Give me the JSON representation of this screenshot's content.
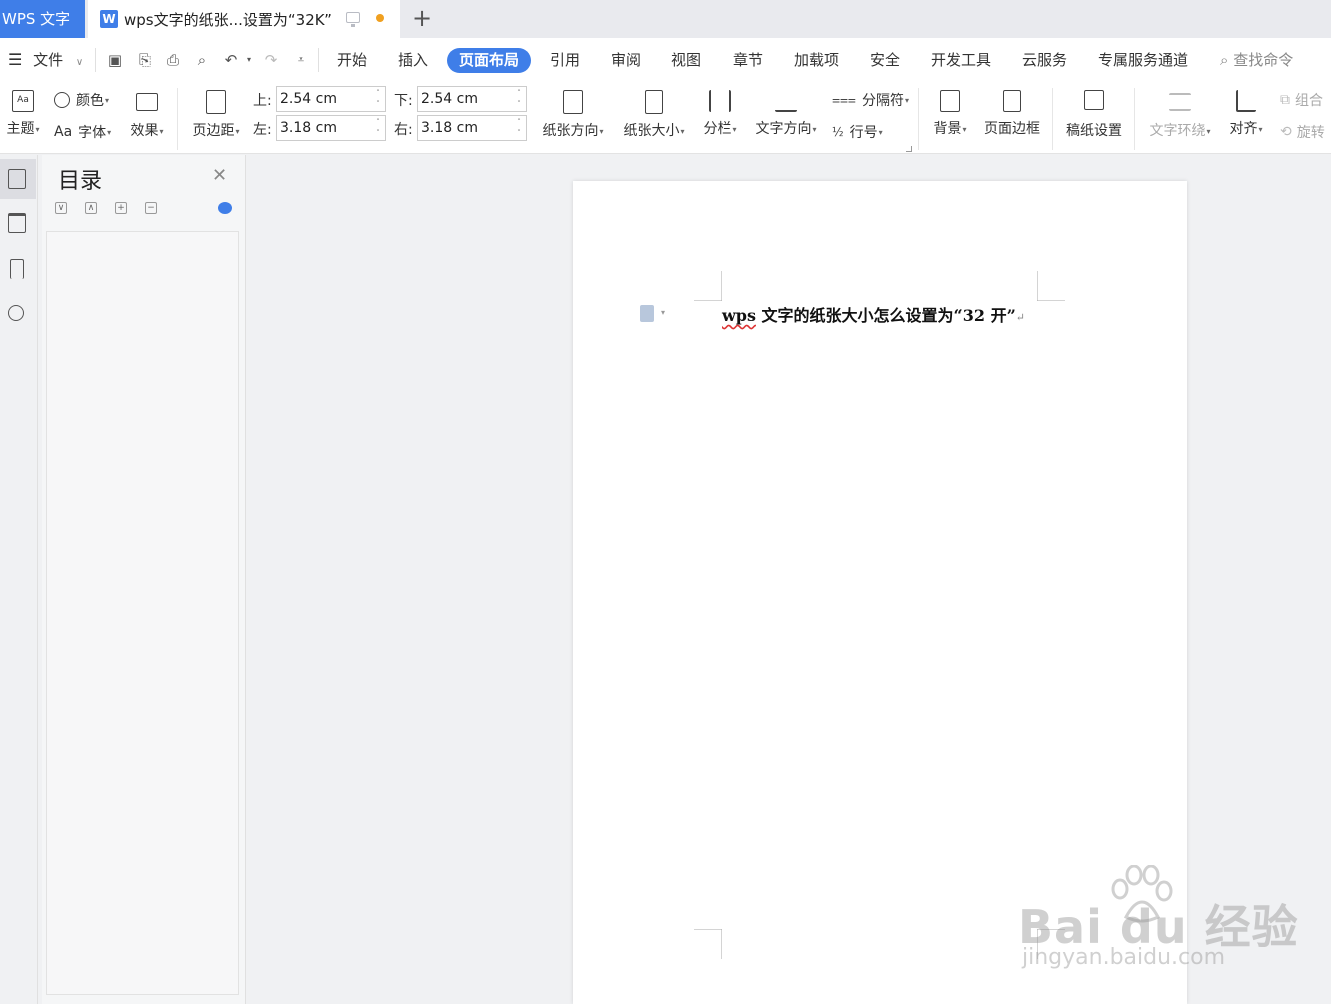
{
  "titlebar": {
    "app_name": "WPS 文字",
    "doc_tab_icon": "W",
    "doc_tab_title": "wps文字的纸张...设置为“32K”",
    "new_tab": "+"
  },
  "menu": {
    "file": "文件",
    "items": [
      "开始",
      "插入",
      "页面布局",
      "引用",
      "审阅",
      "视图",
      "章节",
      "加载项",
      "安全",
      "开发工具",
      "云服务",
      "专属服务通道"
    ],
    "active": "页面布局",
    "search_placeholder": "查找命令"
  },
  "ribbon": {
    "theme": "主题",
    "color": "颜色",
    "font": "字体",
    "font_prefix": "Aa",
    "effect": "效果",
    "margins": "页边距",
    "margin_top_label": "上:",
    "margin_top_value": "2.54 cm",
    "margin_bottom_label": "下:",
    "margin_bottom_value": "2.54 cm",
    "margin_left_label": "左:",
    "margin_left_value": "3.18 cm",
    "margin_right_label": "右:",
    "margin_right_value": "3.18 cm",
    "orientation": "纸张方向",
    "paper_size": "纸张大小",
    "columns": "分栏",
    "text_direction": "文字方向",
    "breaks": "分隔符",
    "line_numbers": "行号",
    "background": "背景",
    "page_border": "页面边框",
    "manuscript": "稿纸设置",
    "text_wrap": "文字环绕",
    "align": "对齐",
    "group": "组合",
    "rotate": "旋转"
  },
  "toc": {
    "title": "目录"
  },
  "document": {
    "heading_prefix": "wps",
    "heading_rest": " 文字的纸张大小怎么设置为“32 开”",
    "para_mark": "↵"
  },
  "watermark": {
    "brand": "Bai du 经验",
    "url": "jingyan.baidu.com"
  },
  "colors": {
    "accent": "#3f7ee8",
    "unsaved": "#f0a020"
  }
}
